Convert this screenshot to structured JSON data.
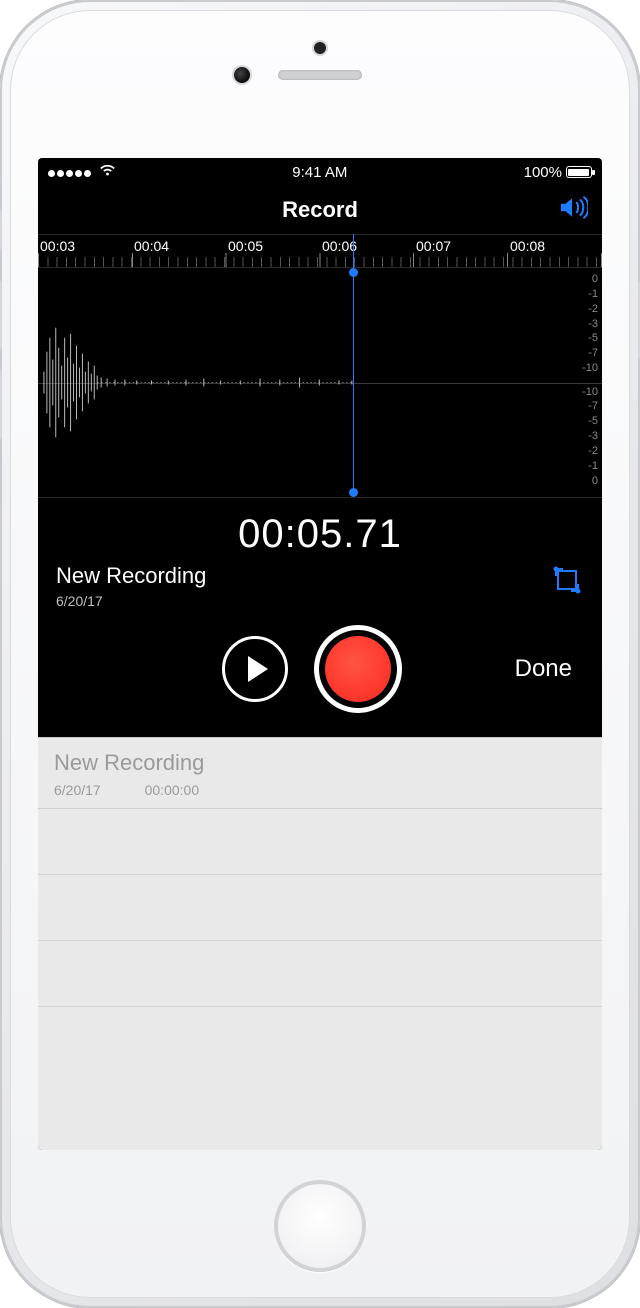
{
  "status": {
    "time": "9:41 AM",
    "battery": "100%"
  },
  "nav": {
    "title": "Record"
  },
  "ruler": {
    "marks": [
      "00:03",
      "00:04",
      "00:05",
      "00:06",
      "00:07",
      "00:08"
    ]
  },
  "db_labels": [
    "0",
    "-1",
    "-2",
    "-3",
    "-5",
    "-7",
    "-10"
  ],
  "timer": "00:05.71",
  "recording": {
    "name": "New Recording",
    "date": "6/20/17"
  },
  "controls": {
    "done": "Done"
  },
  "list": [
    {
      "name": "New Recording",
      "date": "6/20/17",
      "duration": "00:00:00"
    }
  ],
  "colors": {
    "accent": "#1f7bff",
    "record": "#ff3b2f"
  }
}
